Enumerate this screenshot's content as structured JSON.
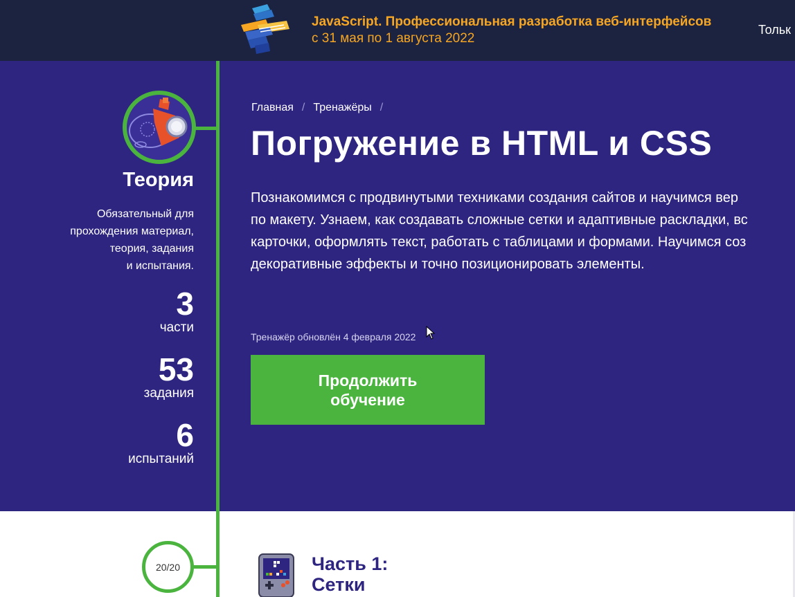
{
  "banner": {
    "title": "JavaScript. Профессиональная разработка веб-интерфейсов",
    "dates": "с 31 мая по 1 августа 2022",
    "right_text": "Тольк",
    "logo_icon": "stacked-layers-logo-icon"
  },
  "sidebar": {
    "title": "Теория",
    "description": [
      "Обязательный для",
      "прохождения материал,",
      "теория, задания",
      "и испытания."
    ],
    "stats": [
      {
        "value": "3",
        "label": "части"
      },
      {
        "value": "53",
        "label": "задания"
      },
      {
        "value": "6",
        "label": "испытаний"
      }
    ]
  },
  "breadcrumbs": {
    "items": [
      "Главная",
      "Тренажёры"
    ],
    "separator": "/"
  },
  "main": {
    "title": "Погружение в HTML и CSS",
    "description_lines": [
      "Познакомимся с продвинутыми техниками создания сайтов и научимся вер",
      "по макету. Узнаем, как создавать сложные сетки и адаптивные раскладки, вс",
      "карточки, оформлять текст, работать с таблицами и формами. Научимся соз",
      "декоративные эффекты и точно позиционировать элементы."
    ],
    "updated": "Тренажёр обновлён 4 февраля 2022",
    "cta_line1": "Продолжить",
    "cta_line2": "обучение"
  },
  "part1": {
    "progress": "20/20",
    "title_line1": "Часть 1:",
    "title_line2": "Сетки",
    "icon": "game-console-icon"
  },
  "colors": {
    "banner_bg": "#1b2340",
    "banner_accent": "#f6a623",
    "hero_bg": "#2e2580",
    "green": "#4ab43f",
    "part_title": "#2e2580"
  }
}
